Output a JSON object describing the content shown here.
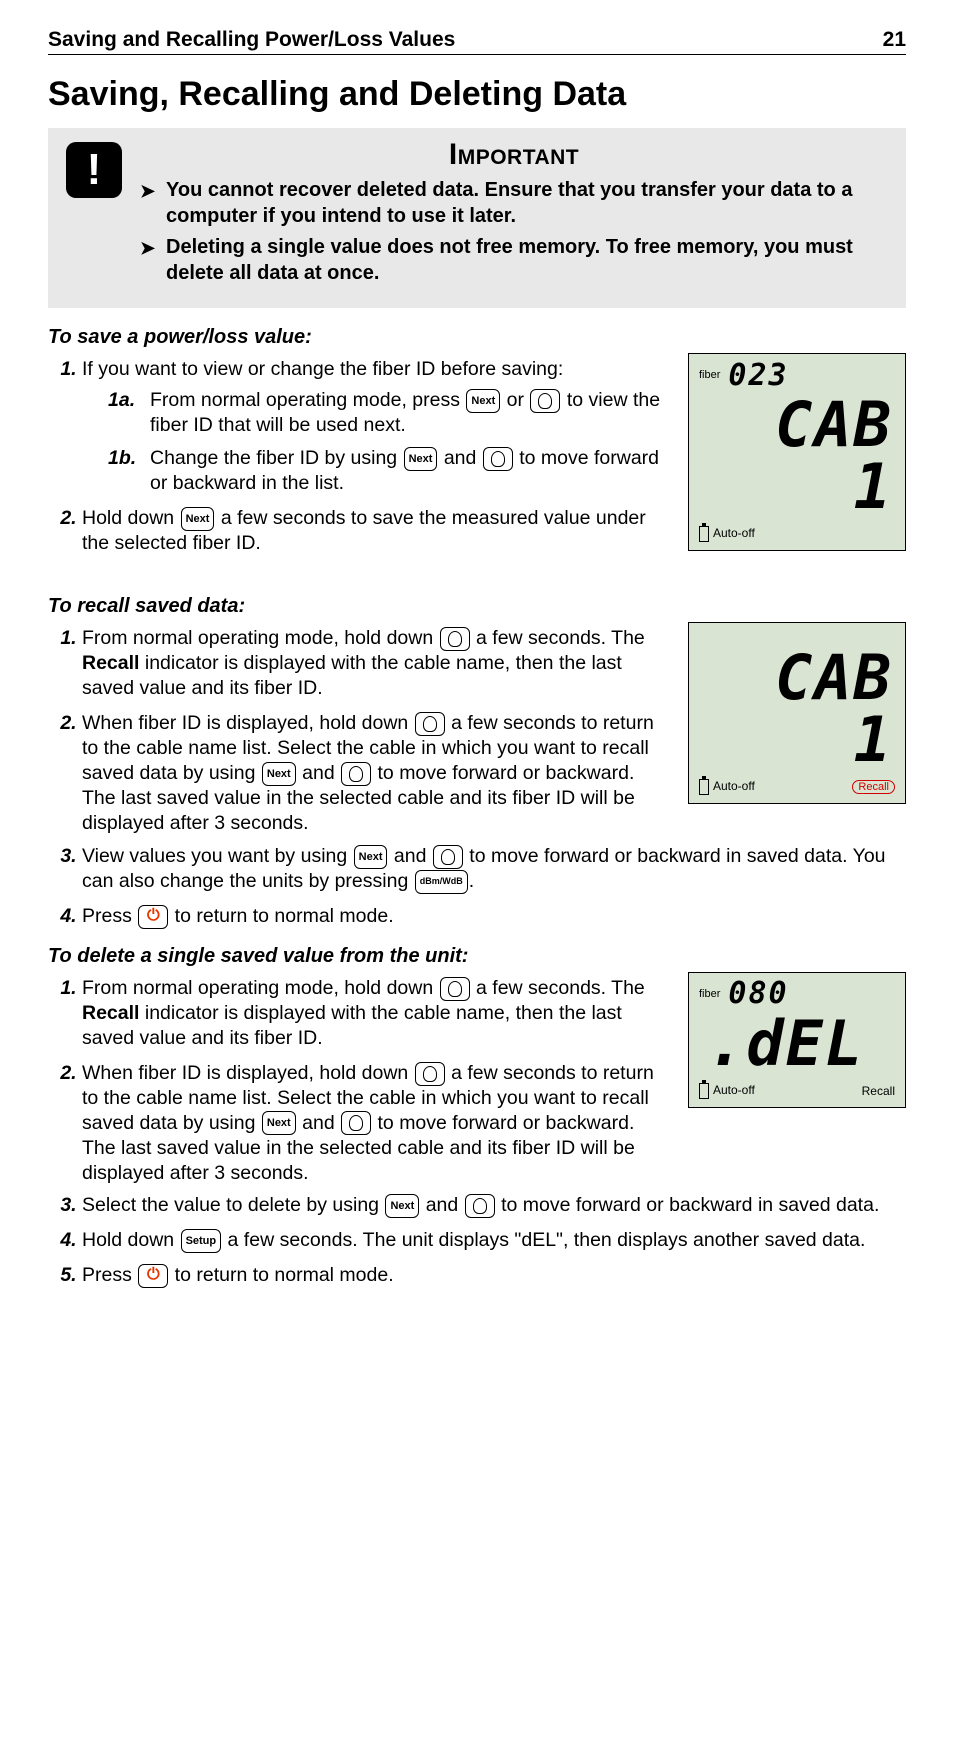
{
  "header": {
    "title": "Saving and Recalling Power/Loss Values",
    "page": "21"
  },
  "section_title": "Saving, Recalling and Deleting Data",
  "callout": {
    "heading": "Important",
    "items": [
      "You cannot recover deleted data. Ensure that you transfer your data to a computer if you intend to use it later.",
      "Deleting a single value does not free memory. To free memory, you must delete all data at once."
    ]
  },
  "keys": {
    "next": "Next",
    "setup": "Setup",
    "dbm_top": "dBm/W",
    "dbm_bot": "dB",
    "power": "⏻"
  },
  "proc_save": {
    "title": "To save a power/loss value:",
    "step1": "If you want to view or change the fiber ID before saving:",
    "s1a_a": "From normal operating mode, press ",
    "s1a_b": " or ",
    "s1a_c": " to view the fiber ID that will be used next.",
    "s1b_a": "Change the fiber ID by using ",
    "s1b_b": " and ",
    "s1b_c": " to move forward or backward in the list.",
    "s2_a": "Hold down ",
    "s2_b": " a few seconds to save the measured value under the selected fiber ID."
  },
  "lcd1": {
    "fiber": "fiber",
    "id": "023",
    "main": "CAB 1",
    "auto": "Auto-off"
  },
  "proc_recall": {
    "title": "To recall saved data:",
    "s1_a": "From normal operating mode, hold down ",
    "s1_b": " a few seconds. The ",
    "s1_bold": "Recall",
    "s1_c": " indicator is displayed with the cable name, then the last saved value and its fiber ID.",
    "s2_a": "When fiber ID is displayed, hold down ",
    "s2_b": " a few seconds to return to the cable name list. Select the cable in which you want to recall saved data by using ",
    "s2_c": " and ",
    "s2_d": " to move forward or backward. The last saved value in the selected cable and its fiber ID will be displayed after 3 seconds.",
    "s3_a": "View values you want by using ",
    "s3_b": " and ",
    "s3_c": " to move forward or backward in saved data. You can also change the units by pressing ",
    "s3_d": ".",
    "s4_a": "Press ",
    "s4_b": " to return to normal mode."
  },
  "lcd2": {
    "main": "CAB 1",
    "auto": "Auto-off",
    "recall": "Recall"
  },
  "proc_delete": {
    "title": "To delete a single saved value from the unit:",
    "s1_a": "From normal operating mode, hold down ",
    "s1_b": " a few seconds. The ",
    "s1_bold": "Recall",
    "s1_c": " indicator is displayed with the cable name, then the last saved value and its fiber ID.",
    "s2_a": "When fiber ID is displayed, hold down ",
    "s2_b": " a few seconds to return to the cable name list. Select the cable in which you want to recall saved data by using ",
    "s2_c": " and ",
    "s2_d": " to move forward or backward. The last saved value in the selected cable and its fiber ID will be displayed after 3 seconds.",
    "s3_a": "Select the value to delete by using ",
    "s3_b": " and ",
    "s3_c": " to move forward or backward in saved data.",
    "s4_a": "Hold down ",
    "s4_b": " a few seconds. The unit displays \"dEL\", then displays another saved data.",
    "s5_a": "Press ",
    "s5_b": " to return to normal mode."
  },
  "lcd3": {
    "fiber": "fiber",
    "id": "080",
    "main": ".dEL",
    "auto": "Auto-off",
    "recall": "Recall"
  }
}
